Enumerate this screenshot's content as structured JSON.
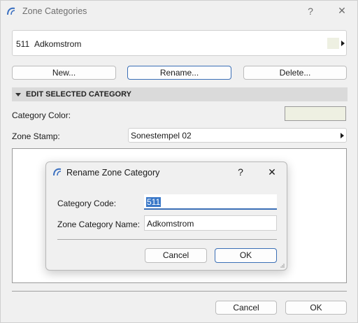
{
  "main_window": {
    "title": "Zone Categories",
    "help_glyph": "?",
    "close_glyph": "✕",
    "selected_category": {
      "code": "511",
      "name": "Adkomstrom",
      "color": "#eef0e2"
    },
    "buttons": {
      "new": "New...",
      "rename": "Rename...",
      "delete": "Delete..."
    },
    "section_header": "EDIT SELECTED CATEGORY",
    "category_color_label": "Category Color:",
    "category_color_value": "#eef0e2",
    "zone_stamp_label": "Zone Stamp:",
    "zone_stamp_value": "Sonestempel 02",
    "cancel": "Cancel",
    "ok": "OK"
  },
  "rename_dialog": {
    "title": "Rename Zone Category",
    "help_glyph": "?",
    "close_glyph": "✕",
    "category_code_label": "Category Code:",
    "category_code_value": "511",
    "zone_category_name_label": "Zone Category Name:",
    "zone_category_name_value": "Adkomstrom",
    "cancel": "Cancel",
    "ok": "OK"
  },
  "colors": {
    "accent": "#3b6fb6",
    "selection_bg": "#3a78c8",
    "section_bg": "#dadada"
  },
  "icons": {
    "app_icon": "archicad-arc-icon",
    "dropdown_arrow": "triangle-right-icon",
    "collapse_arrow": "triangle-down-icon",
    "resize_grip": "resize-grip-icon"
  }
}
